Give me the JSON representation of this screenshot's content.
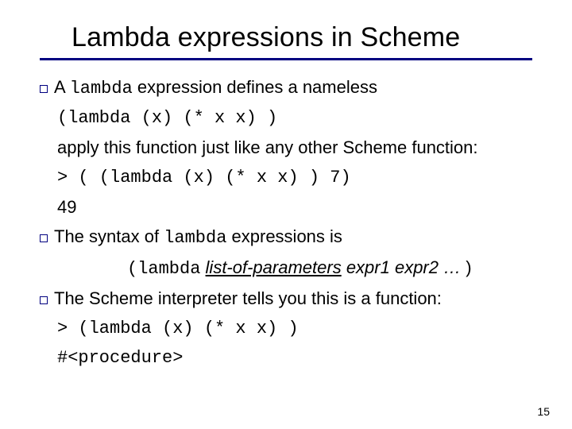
{
  "title": "Lambda expressions in Scheme",
  "b1_pre": "A ",
  "b1_code": "lambda",
  "b1_post": " expression defines a nameless",
  "code1": "(lambda (x)  (* x x) )",
  "line2": "apply this function just like any other Scheme function:",
  "code2": "> ( (lambda (x) (* x x) ) 7)",
  "result1": "49",
  "b2_pre": "The syntax of ",
  "b2_code": "lambda",
  "b2_post": " expressions is",
  "syntax_open": "(",
  "syntax_kw": "lambda",
  "syntax_sp": " ",
  "syntax_list": "list-of-parameters",
  "syntax_rest": "  expr1 expr2 … ",
  "syntax_close": ")",
  "b3": "The Scheme interpreter tells you this is a function:",
  "code3": "> (lambda (x) (* x x) )",
  "result2": "#<procedure>",
  "page": "15"
}
